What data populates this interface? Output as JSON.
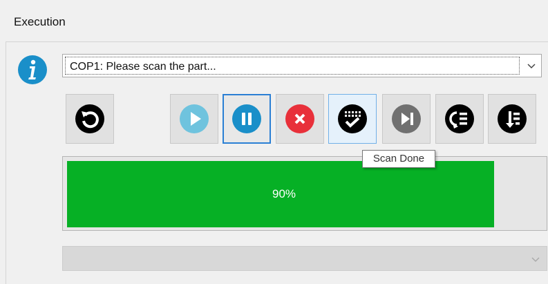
{
  "window": {
    "title": "Execution"
  },
  "message_combo": {
    "value": "COP1: Please scan the part..."
  },
  "toolbar": {
    "buttons": [
      {
        "name": "reset",
        "icon": "reset-icon",
        "state": "normal"
      },
      {
        "name": "play",
        "icon": "play-icon",
        "state": "disabled"
      },
      {
        "name": "pause",
        "icon": "pause-icon",
        "state": "active"
      },
      {
        "name": "cancel",
        "icon": "cancel-icon",
        "state": "normal"
      },
      {
        "name": "scan-done",
        "icon": "scan-done-icon",
        "state": "hover"
      },
      {
        "name": "skip",
        "icon": "skip-icon",
        "state": "disabled"
      },
      {
        "name": "prev-list",
        "icon": "previous-list-icon",
        "state": "normal"
      },
      {
        "name": "next-list",
        "icon": "next-list-icon",
        "state": "normal"
      }
    ]
  },
  "tooltip": {
    "text": "Scan Done"
  },
  "progress": {
    "value": 0.9,
    "label": "90%",
    "color": "#06b025"
  },
  "bottom_combo": {
    "value": ""
  },
  "colors": {
    "info": "#1a8fc9",
    "pause": "#1a8fc9",
    "cancel": "#e8303a",
    "play_disabled": "#6fc3de"
  }
}
